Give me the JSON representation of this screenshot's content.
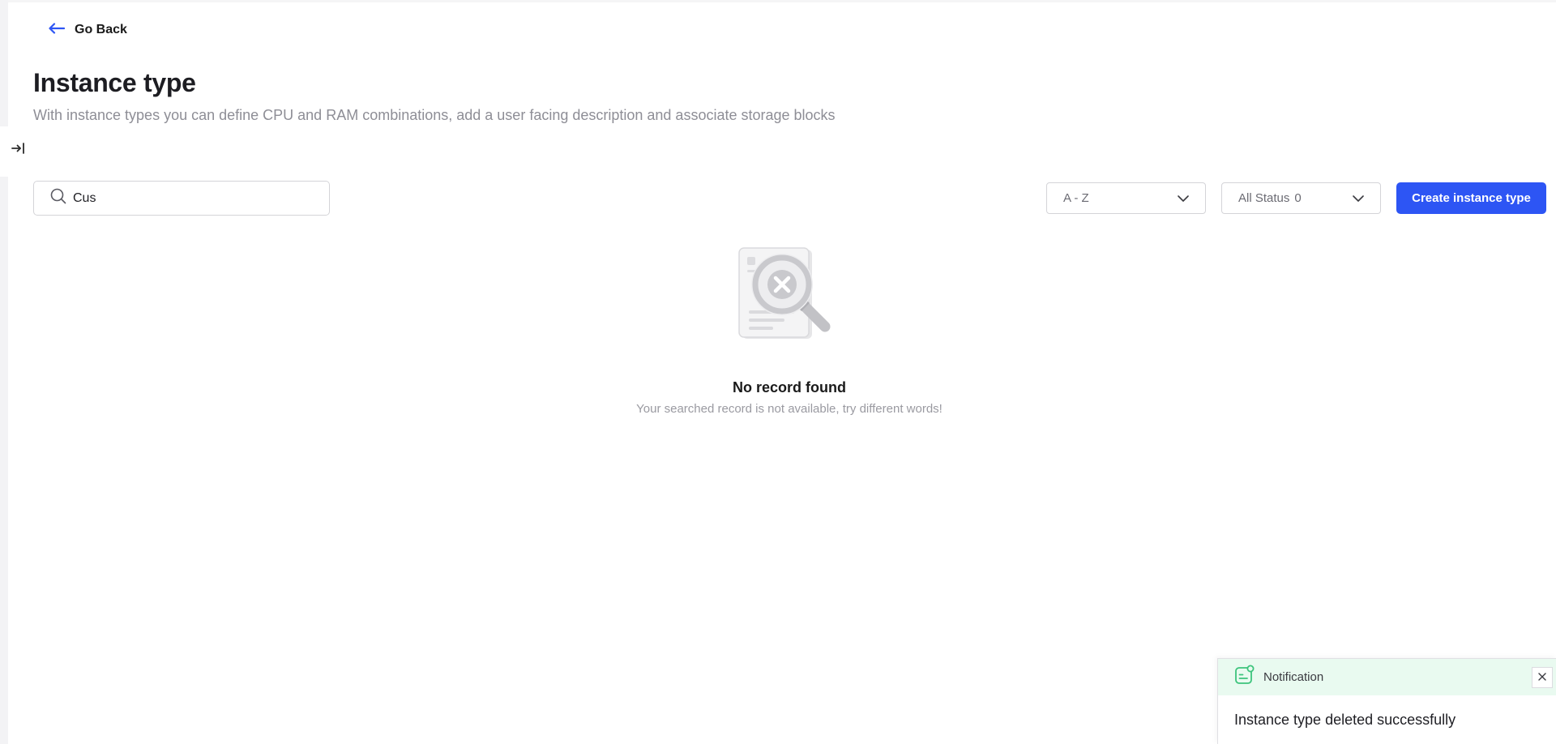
{
  "nav": {
    "go_back_label": "Go Back"
  },
  "header": {
    "title": "Instance type",
    "subtitle": "With instance types you can define CPU and RAM combinations, add a user facing description and associate storage blocks"
  },
  "toolbar": {
    "search_value": "Cus",
    "sort_selected": "A - Z",
    "status_filter_label": "All Status",
    "status_filter_count": "0",
    "create_label": "Create instance type"
  },
  "empty_state": {
    "title": "No record found",
    "message": "Your searched record is not available, try different words!"
  },
  "notification": {
    "title": "Notification",
    "message": "Instance type deleted successfully"
  },
  "colors": {
    "primary": "#2d55f4",
    "notification_bg": "#e9faf0",
    "notification_icon": "#3cc47c"
  },
  "icons": {
    "back": "arrow-left-icon",
    "sidebar": "collapse-sidebar-icon",
    "search": "search-icon",
    "dropdown": "chevron-down-icon",
    "empty": "no-results-magnifier-icon",
    "notification": "notification-icon",
    "close": "close-icon"
  }
}
